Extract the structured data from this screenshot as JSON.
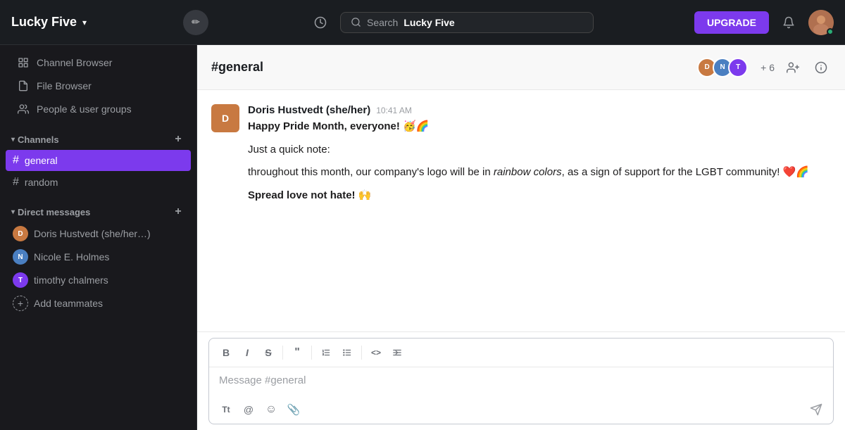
{
  "topbar": {
    "workspace_name": "Lucky Five",
    "search_placeholder": "Search",
    "search_workspace": "Lucky Five",
    "upgrade_label": "UPGRADE",
    "history_icon": "🕐"
  },
  "sidebar": {
    "nav_items": [
      {
        "id": "channel-browser",
        "label": "Channel Browser",
        "icon": "⊞"
      },
      {
        "id": "file-browser",
        "label": "File Browser",
        "icon": "📄"
      },
      {
        "id": "people-user-groups",
        "label": "People & user groups",
        "icon": "👥"
      }
    ],
    "channels_label": "Channels",
    "channels": [
      {
        "id": "general",
        "name": "general",
        "active": true
      },
      {
        "id": "random",
        "name": "random",
        "active": false
      }
    ],
    "dm_label": "Direct messages",
    "dms": [
      {
        "id": "doris",
        "name": "Doris Hustvedt (she/her…)",
        "color": "#c87941"
      },
      {
        "id": "nicole",
        "name": "Nicole E. Holmes",
        "color": "#4a7fc1"
      },
      {
        "id": "timothy",
        "name": "timothy chalmers",
        "color": "#7c3aed"
      }
    ],
    "add_teammates": "Add teammates",
    "user_name": "timothy chalmers"
  },
  "chat": {
    "channel_name": "#general",
    "member_count": "+ 6",
    "messages": [
      {
        "id": "msg1",
        "author": "Doris Hustvedt (she/her)",
        "time": "10:41 AM",
        "paragraphs": [
          "Happy Pride Month, everyone! 🥳🌈",
          "Just a quick note:",
          "throughout this month, our company's logo will be in rainbow colors, as a sign of support for the LGBT community! ❤️🌈",
          "Spread love not hate! 🙌"
        ],
        "italic_phrase": "rainbow colors",
        "bold_phrase": "Spread love not hate!"
      }
    ]
  },
  "composer": {
    "placeholder": "Message #general",
    "toolbar": {
      "bold": "B",
      "italic": "I",
      "strikethrough": "S",
      "quote": "\"",
      "ordered_list": "ol",
      "unordered_list": "ul",
      "code": "<>",
      "indent": ">>"
    }
  },
  "icons": {
    "edit": "✏",
    "bell": "🔔",
    "add_member": "👤+",
    "info": "ℹ",
    "send": "➤",
    "at": "@",
    "emoji": "☺",
    "attach": "📎",
    "text_format": "Tt"
  }
}
